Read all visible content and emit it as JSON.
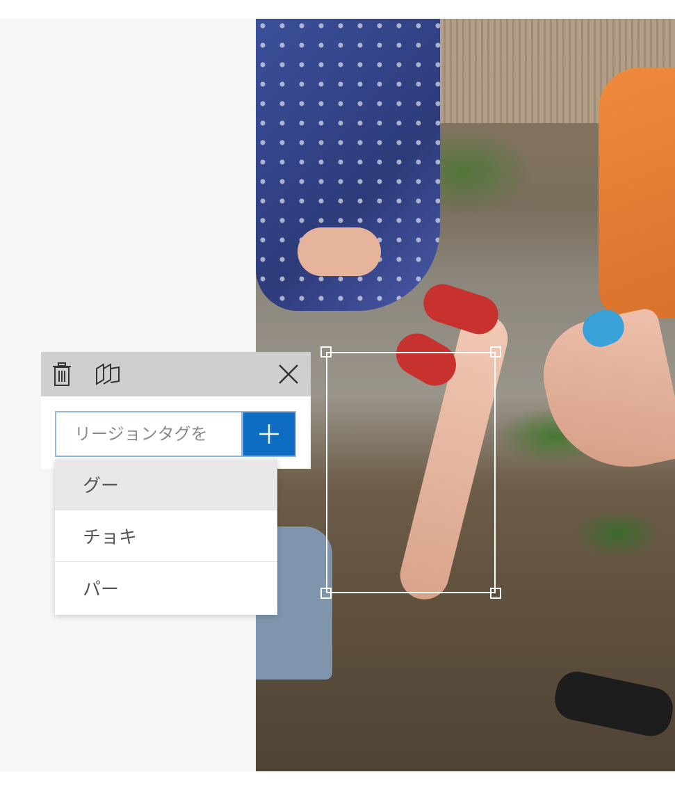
{
  "toolbar": {
    "delete_icon": "trash-icon",
    "copy_icon": "copy-region-icon",
    "close_icon": "close-icon"
  },
  "tag_input": {
    "placeholder": "リージョンタグを"
  },
  "add_button": {
    "icon": "plus-icon"
  },
  "suggestions": [
    {
      "label": "グー"
    },
    {
      "label": "チョキ"
    },
    {
      "label": "パー"
    }
  ],
  "colors": {
    "accent": "#0d6cc1",
    "panel_bg": "#f6f6f6",
    "toolbar_bg": "#cfcfcf",
    "input_border": "#8fb6e2",
    "selected_item_bg": "#e8e8e8"
  }
}
